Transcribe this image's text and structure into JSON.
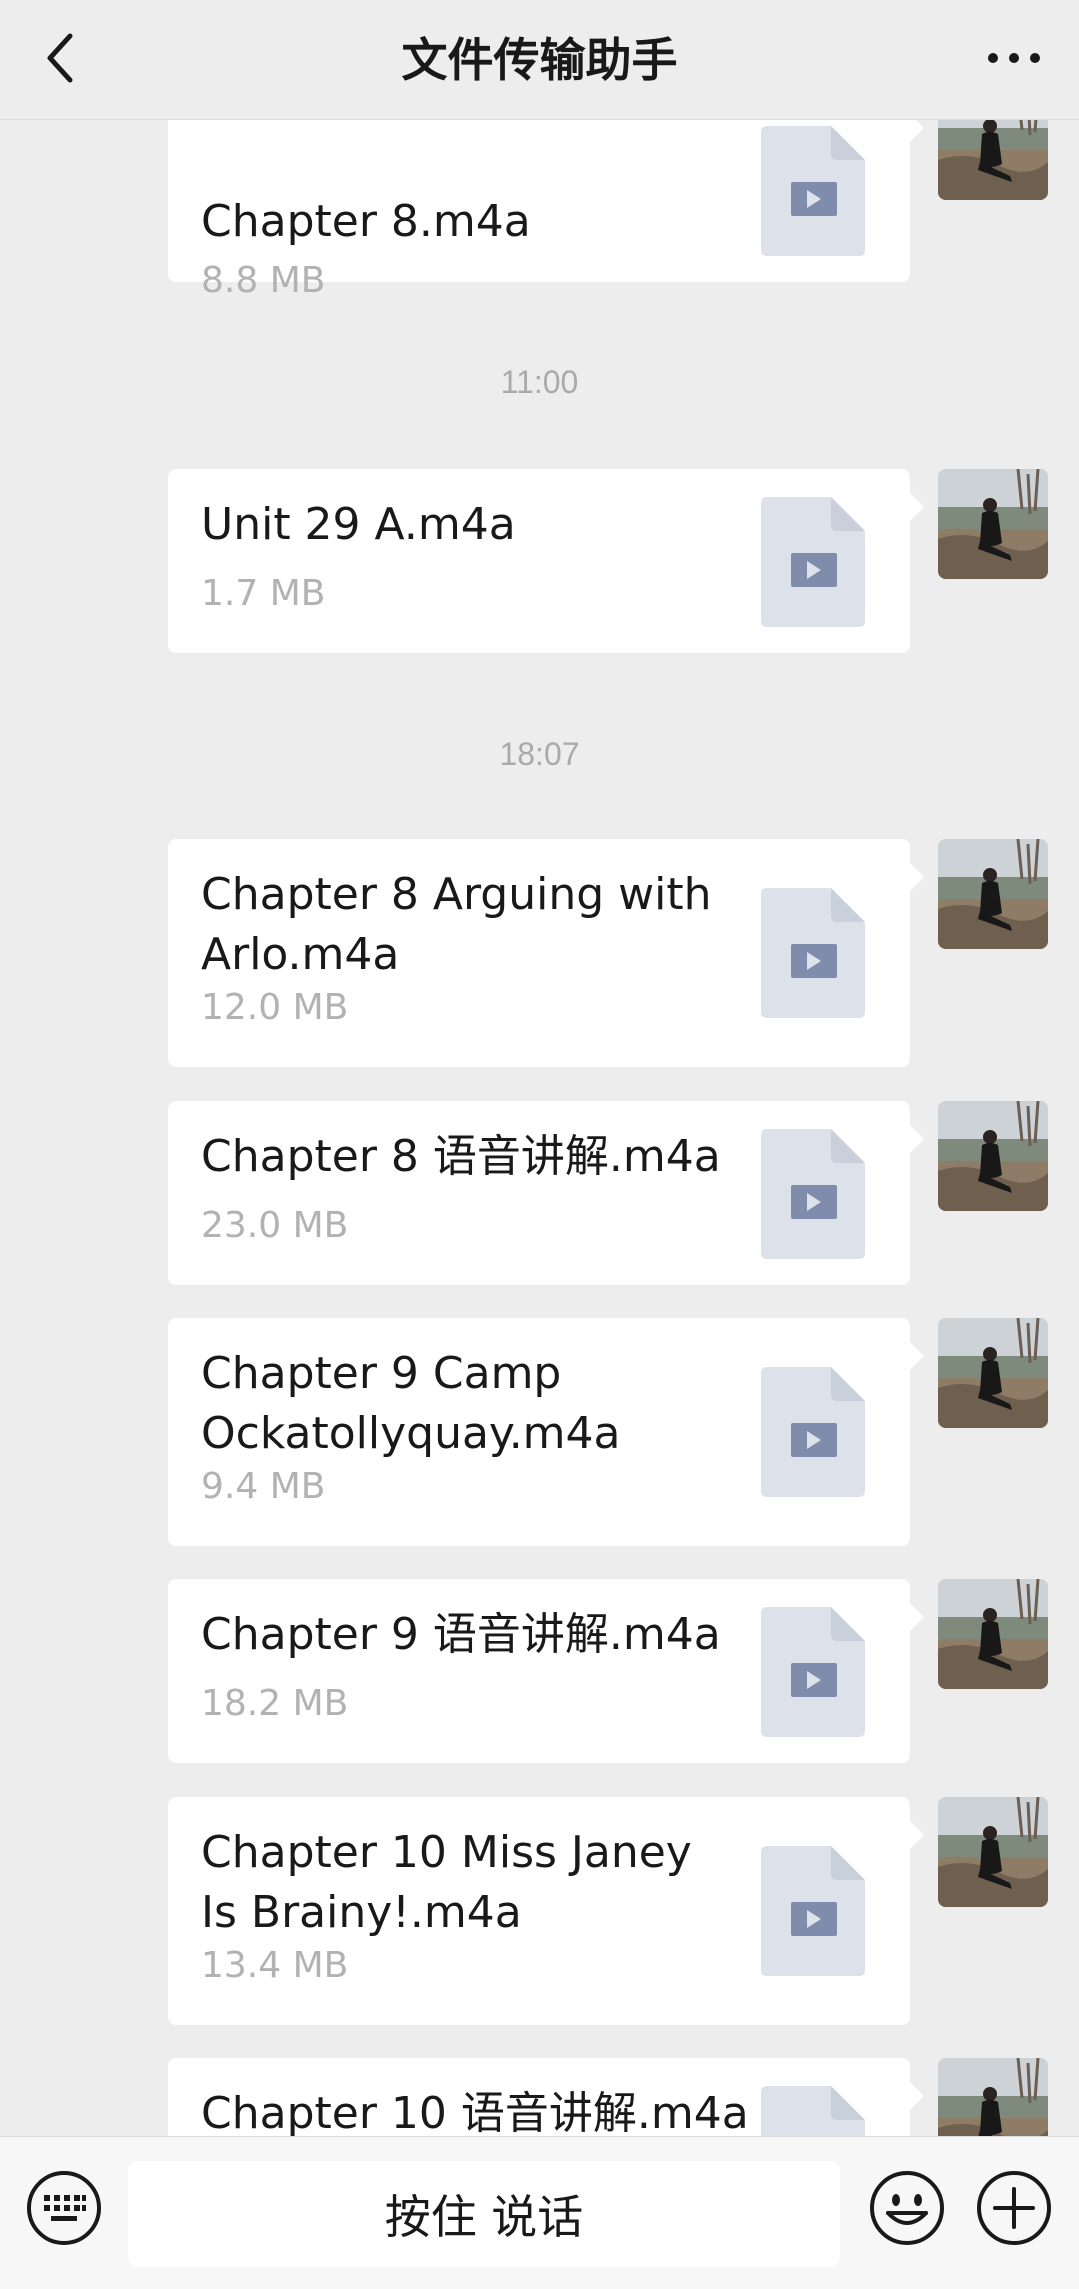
{
  "header": {
    "title": "文件传输助手",
    "back_icon": "chevron-left-icon",
    "more_icon": "ellipsis-icon"
  },
  "timestamps": [
    "11:00",
    "18:07"
  ],
  "messages": [
    {
      "name": "Chapter 8.m4a",
      "size": "8.8 MB"
    },
    {
      "name": "Unit 29 A.m4a",
      "size": "1.7 MB"
    },
    {
      "name": "Chapter 8 Arguing with Arlo.m4a",
      "size": "12.0 MB"
    },
    {
      "name": "Chapter 8 语音讲解.m4a",
      "size": "23.0 MB"
    },
    {
      "name": "Chapter 9 Camp Ockatollyquay.m4a",
      "size": "9.4 MB"
    },
    {
      "name": "Chapter 9 语音讲解.m4a",
      "size": "18.2 MB"
    },
    {
      "name": "Chapter 10 Miss Janey Is Brainy!.m4a",
      "size": "13.4 MB"
    },
    {
      "name": "Chapter 10 语音讲解.m4a",
      "size": ""
    }
  ],
  "bottom": {
    "hold_to_talk": "按住 说话",
    "icons": [
      "keyboard-icon",
      "emoji-icon",
      "plus-icon"
    ]
  },
  "colors": {
    "background": "#ededed",
    "bubble": "#ffffff",
    "file_icon": "#dde1ea",
    "file_icon_play": "#7f8cab",
    "size_text": "#b2b2b2",
    "timestamp_text": "#aaaaaa"
  }
}
